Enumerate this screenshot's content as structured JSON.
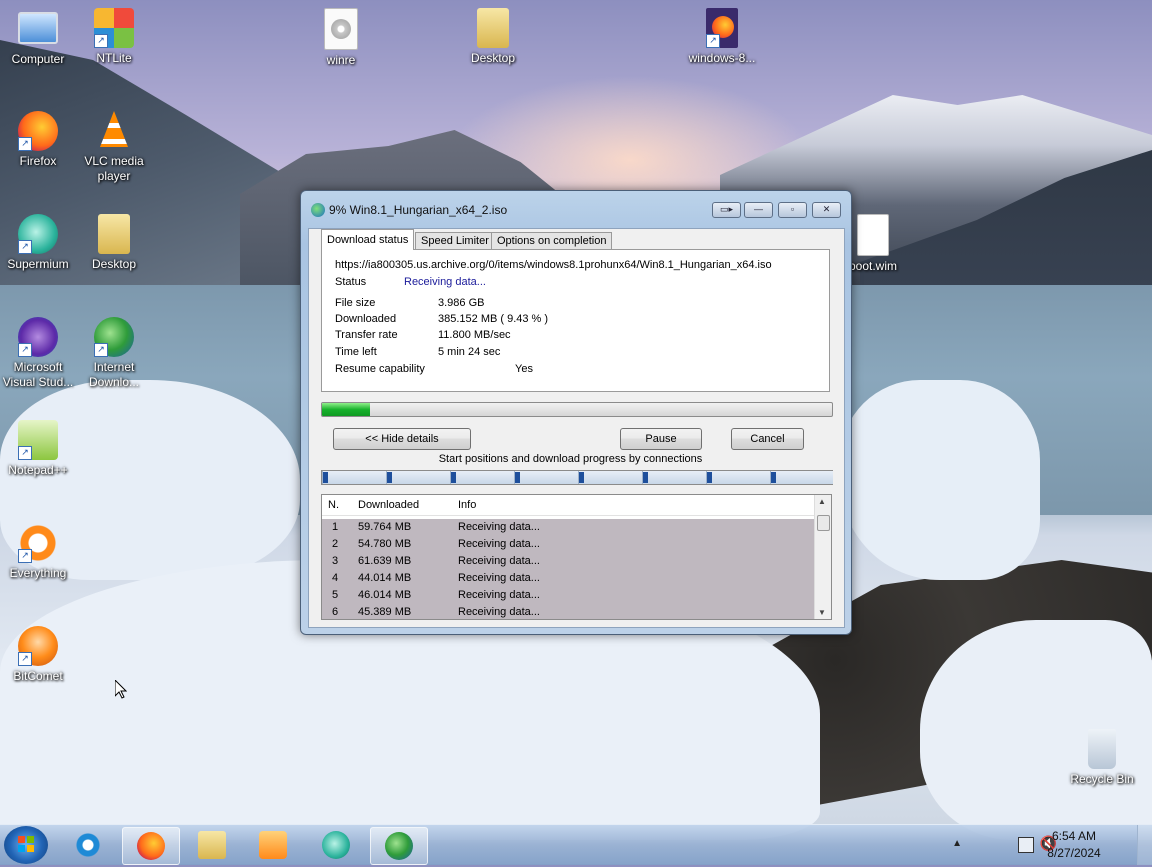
{
  "desktop": {
    "icons": [
      {
        "label": "Computer"
      },
      {
        "label": "NTLite"
      },
      {
        "label": "winre"
      },
      {
        "label": "Desktop"
      },
      {
        "label": "windows-8..."
      },
      {
        "label": "Firefox"
      },
      {
        "label": "VLC media player"
      },
      {
        "label": "Supermium"
      },
      {
        "label": "Desktop"
      },
      {
        "label": "boot.wim"
      },
      {
        "label": "Microsoft Visual Stud..."
      },
      {
        "label": "Internet Downlo..."
      },
      {
        "label": "Notepad++"
      },
      {
        "label": "Everything"
      },
      {
        "label": "BitComet"
      },
      {
        "label": "Recycle Bin"
      }
    ]
  },
  "dialog": {
    "title": "9% Win8.1_Hungarian_x64_2.iso",
    "tabs": [
      {
        "label": "Download status"
      },
      {
        "label": "Speed Limiter"
      },
      {
        "label": "Options on completion"
      }
    ],
    "url": "https://ia800305.us.archive.org/0/items/windows8.1prohunx64/Win8.1_Hungarian_x64.iso",
    "status_label": "Status",
    "status_value": "Receiving data...",
    "fields": {
      "file_size_label": "File size",
      "file_size_value": "3.986  GB",
      "downloaded_label": "Downloaded",
      "downloaded_value": "385.152  MB  ( 9.43 % )",
      "transfer_rate_label": "Transfer rate",
      "transfer_rate_value": "11.800  MB/sec",
      "time_left_label": "Time left",
      "time_left_value": "5 min 24 sec",
      "resume_label": "Resume capability",
      "resume_value": "Yes"
    },
    "progress_fraction": 0.0943,
    "buttons": {
      "hide_details": "<< Hide details",
      "pause": "Pause",
      "cancel": "Cancel"
    },
    "connections_label": "Start positions and download progress by connections",
    "list": {
      "headers": {
        "n": "N.",
        "downloaded": "Downloaded",
        "info": "Info"
      },
      "rows": [
        {
          "n": "1",
          "downloaded": "59.764  MB",
          "info": "Receiving data..."
        },
        {
          "n": "2",
          "downloaded": "54.780  MB",
          "info": "Receiving data..."
        },
        {
          "n": "3",
          "downloaded": "61.639  MB",
          "info": "Receiving data..."
        },
        {
          "n": "4",
          "downloaded": "44.014  MB",
          "info": "Receiving data..."
        },
        {
          "n": "5",
          "downloaded": "46.014  MB",
          "info": "Receiving data..."
        },
        {
          "n": "6",
          "downloaded": "45.389  MB",
          "info": "Receiving data..."
        }
      ]
    }
  },
  "taskbar": {
    "time": "6:54 AM",
    "date": "8/27/2024"
  },
  "colors": {
    "status_value": "#1b1b9a",
    "progress_green": "#18b22c",
    "row_bg": "#bfb8bf"
  }
}
